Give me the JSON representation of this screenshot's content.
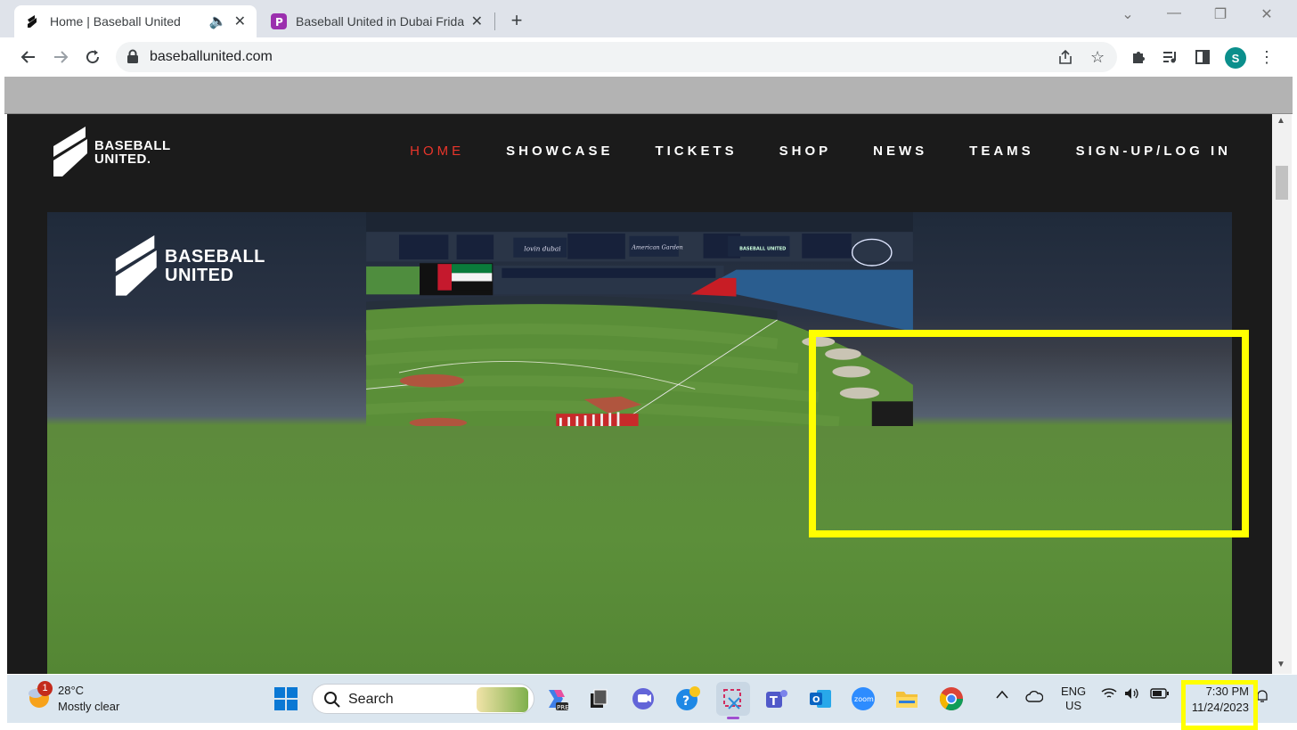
{
  "browser": {
    "tabs": [
      {
        "title": "Home | Baseball United",
        "active": true
      },
      {
        "title": "Baseball United in Dubai Friday …",
        "active": false
      }
    ],
    "url": "baseballunited.com",
    "profile_initial": "S"
  },
  "site": {
    "logo_line1": "BASEBALL",
    "logo_line2": "UNITED.",
    "nav": [
      "HOME",
      "SHOWCASE",
      "TICKETS",
      "SHOP",
      "NEWS",
      "TEAMS",
      "SIGN-UP/LOG IN"
    ],
    "hero": {
      "logo_line1": "BASEBALL",
      "logo_line2": "UNITED",
      "signage": [
        "lovin dubai",
        "American Garden",
        "BASEBALL UNITED"
      ]
    }
  },
  "taskbar": {
    "weather_badge": "1",
    "temperature": "28°C",
    "condition": "Mostly clear",
    "search_label": "Search",
    "lang_line1": "ENG",
    "lang_line2": "US",
    "time": "7:30 PM",
    "date": "11/24/2023"
  },
  "colors": {
    "highlight": "#ffff00",
    "nav_active": "#e8352b",
    "site_bg": "#1b1b1b"
  }
}
